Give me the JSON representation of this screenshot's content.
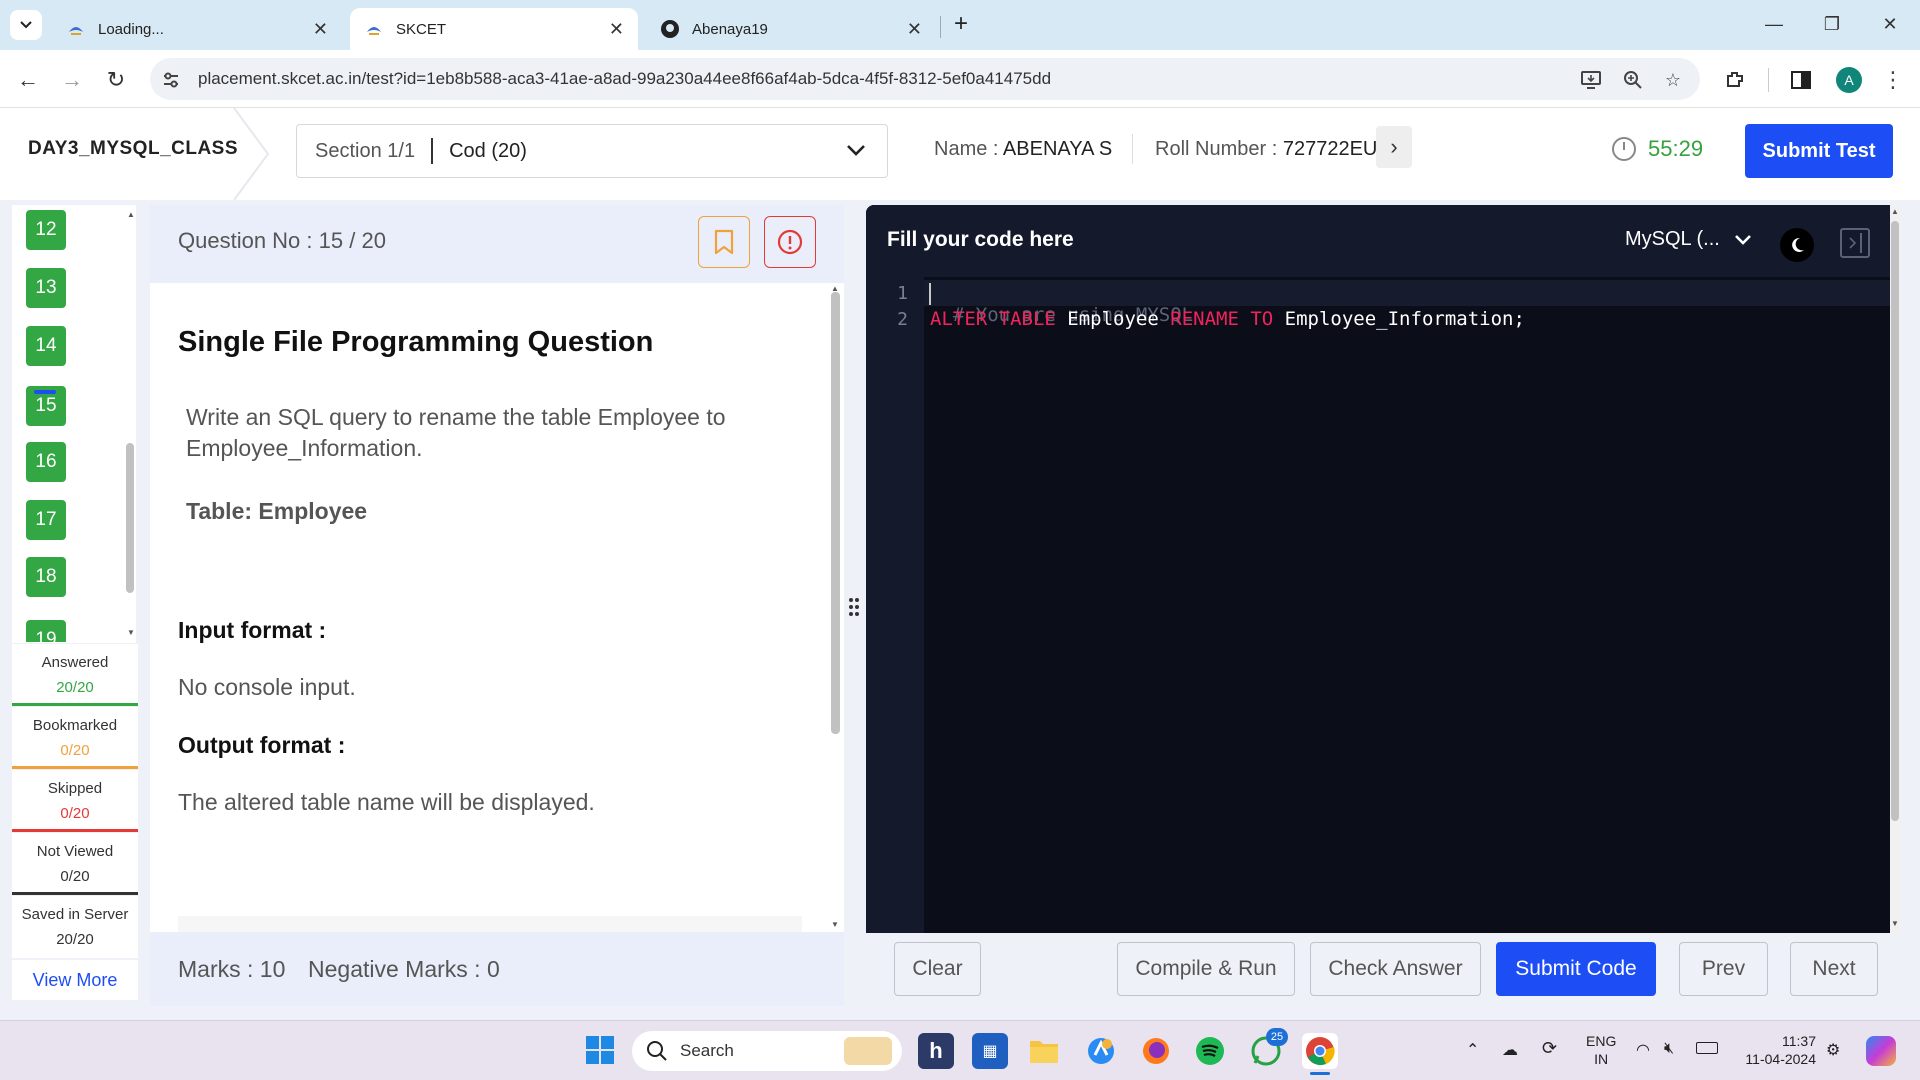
{
  "browser": {
    "tabs": [
      {
        "title": "Loading..."
      },
      {
        "title": "SKCET"
      },
      {
        "title": "Abenaya19"
      }
    ],
    "new_tab": "+",
    "url": "placement.skcet.ac.in/test?id=1eb8b588-aca3-41ae-a8ad-99a230a44ee8f66af4ab-5dca-4f5f-8312-5ef0a41475dd",
    "profile_initial": "A"
  },
  "header": {
    "test_name": "DAY3_MYSQL_CLASS",
    "section": "Section 1/1",
    "section_option": "Cod (20)",
    "name_label": "Name :",
    "name_value": "ABENAYA S",
    "roll_label": "Roll Number :",
    "roll_value": "727722EU",
    "timer": "55:29",
    "submit_test": "Submit Test"
  },
  "question_nav": {
    "numbers": [
      "12",
      "13",
      "14",
      "15",
      "16",
      "17",
      "18",
      "19"
    ],
    "current": "15"
  },
  "stats": [
    {
      "label": "Answered",
      "value": "20/20",
      "color": "#34a745"
    },
    {
      "label": "Bookmarked",
      "value": "0/20",
      "color": "#f0a13a"
    },
    {
      "label": "Skipped",
      "value": "0/20",
      "color": "#e53935"
    },
    {
      "label": "Not Viewed",
      "value": "0/20",
      "color": "#333333"
    },
    {
      "label": "Saved in Server",
      "value": "20/20",
      "color": "#333333"
    }
  ],
  "view_more": "View More",
  "question": {
    "no_label": "Question No : 15",
    "total": "/ 20",
    "title": "Single File Programming Question",
    "description": "Write an SQL query to rename the table Employee to Employee_Information.",
    "table_label": "Table: Employee",
    "input_label": "Input format :",
    "input_value": "No console input.",
    "output_label": "Output format :",
    "output_value": "The altered table name will be displayed.",
    "marks": "Marks : 10",
    "negative_marks": "Negative Marks : 0"
  },
  "editor": {
    "title": "Fill your code here",
    "language": "MySQL (...",
    "line_numbers": [
      "1",
      "2"
    ],
    "line1": "# You are using MYSQL",
    "line2_kw1": "ALTER TABLE",
    "line2_id1": "Employee",
    "line2_kw2": "RENAME TO",
    "line2_id2": "Employee_Information;"
  },
  "buttons": {
    "clear": "Clear",
    "compile_run": "Compile & Run",
    "check_answer": "Check Answer",
    "submit_code": "Submit Code",
    "prev": "Prev",
    "next": "Next"
  },
  "taskbar": {
    "search": "Search",
    "whatsapp_badge": "25",
    "lang_top": "ENG",
    "lang_bottom": "IN",
    "time": "11:37",
    "date": "11-04-2024"
  },
  "colors": {
    "accent": "#1d4ef5",
    "answered_green": "#34a745",
    "timer_green": "#37a13d",
    "editor_bg": "#0b0d19",
    "keyword": "#f0245b"
  }
}
